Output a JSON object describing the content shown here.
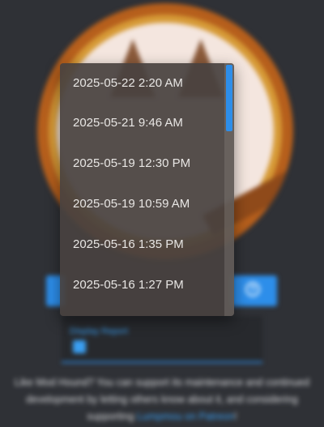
{
  "background": {
    "report_label": "Display Report",
    "support_prefix": "Like Mod Hound? You can support its maintenance and continued development by letting others know about it, and considering supporting ",
    "support_link": "Lumpmou on Patreon",
    "support_suffix": "!"
  },
  "dropdown": {
    "items": [
      {
        "label": "2025-05-22 2:20 AM"
      },
      {
        "label": "2025-05-21 9:46 AM"
      },
      {
        "label": "2025-05-19 12:30 PM"
      },
      {
        "label": "2025-05-19 10:59 AM"
      },
      {
        "label": "2025-05-16 1:35 PM"
      },
      {
        "label": "2025-05-16 1:27 PM"
      }
    ]
  },
  "colors": {
    "accent": "#2d8eea",
    "page_bg": "#2f3136",
    "logo_outer": "#b65f1c",
    "logo_ring": "#d69a36"
  },
  "icons": {
    "help": "help-icon",
    "report": "report-icon"
  }
}
